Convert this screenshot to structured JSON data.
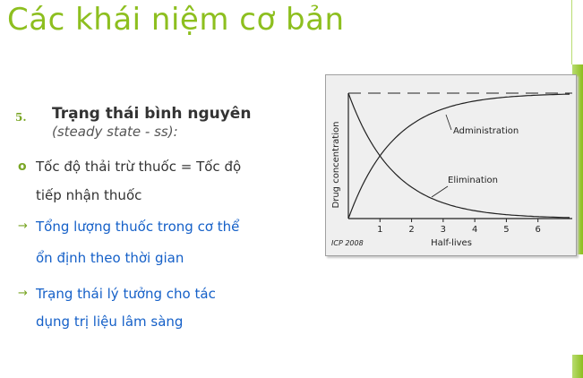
{
  "slide": {
    "title": "Các khái niệm cơ bản",
    "section_number": "5.",
    "heading": "Trạng thái bình nguyên",
    "subheading": "(steady state - ss):",
    "bullets": [
      {
        "marker": "o",
        "lines": [
          "Tốc độ thải trừ thuốc = Tốc độ",
          "tiếp nhận thuốc"
        ],
        "color": "#333333"
      },
      {
        "marker": "→",
        "lines": [
          "Tổng lượng thuốc trong cơ thể",
          "ổn định theo thời gian"
        ],
        "color": "#1560c8"
      },
      {
        "marker": "→",
        "lines": [
          "Trạng thái lý tưởng cho tác",
          "dụng trị liệu lâm sàng"
        ],
        "color": "#1560c8"
      }
    ]
  },
  "colors": {
    "accent": "#8dbf1f",
    "link": "#1560c8",
    "text": "#333333"
  },
  "chart_data": {
    "type": "line",
    "ylabel": "Drug concentration",
    "xlabel": "Half-lives",
    "x_ticks": [
      "1",
      "2",
      "3",
      "4",
      "5",
      "6"
    ],
    "credit": "ICP 2008",
    "xlim": [
      0,
      7
    ],
    "ylim": [
      0,
      1
    ],
    "series": [
      {
        "name": "Administration",
        "x": [
          0,
          1,
          2,
          3,
          4,
          5,
          6,
          7
        ],
        "y": [
          0,
          0.5,
          0.75,
          0.875,
          0.9375,
          0.96875,
          0.984,
          0.992
        ]
      },
      {
        "name": "Elimination",
        "x": [
          0,
          1,
          2,
          3,
          4,
          5,
          6,
          7
        ],
        "y": [
          1,
          0.5,
          0.25,
          0.125,
          0.0625,
          0.03125,
          0.016,
          0.008
        ]
      }
    ],
    "steady_state_line": 1.0
  }
}
